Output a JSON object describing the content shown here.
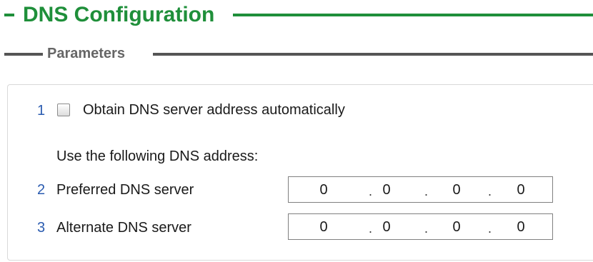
{
  "header": {
    "title": "DNS Configuration"
  },
  "section": {
    "title": "Parameters"
  },
  "options": {
    "auto": {
      "number": "1",
      "label": "Obtain DNS server address automatically",
      "checked": false
    },
    "use_following_label": "Use the following DNS address:",
    "preferred": {
      "number": "2",
      "label": "Preferred DNS server",
      "octets": [
        "0",
        "0",
        "0",
        "0"
      ]
    },
    "alternate": {
      "number": "3",
      "label": "Alternate DNS server",
      "octets": [
        "0",
        "0",
        "0",
        "0"
      ]
    },
    "separator": "."
  },
  "colors": {
    "accent_green": "#1f8f3a",
    "number_blue": "#2a5bb0",
    "section_gray": "#666666"
  }
}
